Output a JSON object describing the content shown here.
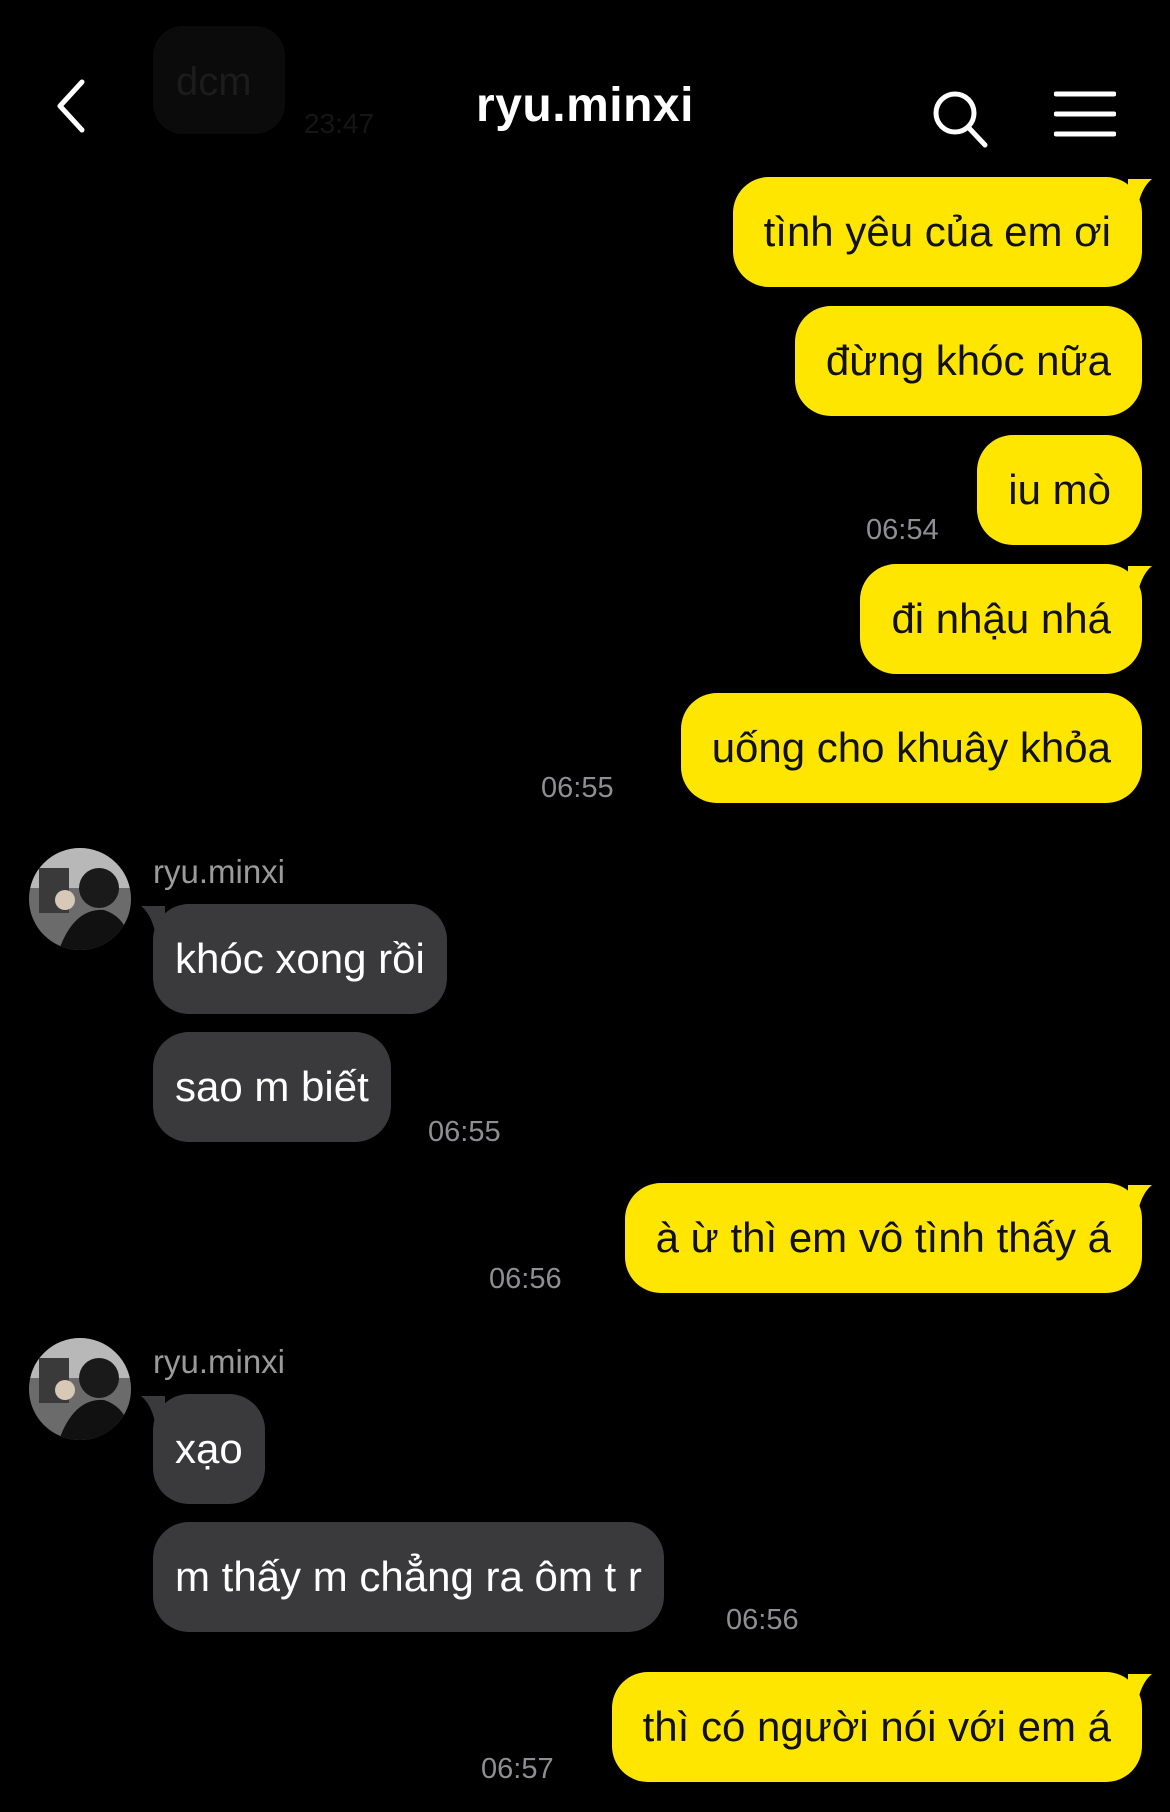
{
  "header": {
    "title": "ryu.minxi",
    "back_icon": "chevron-left-icon",
    "search_icon": "search-icon",
    "menu_icon": "hamburger-menu-icon",
    "previous_message": {
      "text": "dcm",
      "time": "23:47"
    }
  },
  "colors": {
    "background": "#000000",
    "outgoing_bubble": "#ffe600",
    "incoming_bubble": "#3a3a3c",
    "timestamp": "#8e8e93"
  },
  "messages": [
    {
      "direction": "out",
      "text": "tình yêu của em ơi",
      "time": ""
    },
    {
      "direction": "out",
      "text": "đừng khóc nữa",
      "time": ""
    },
    {
      "direction": "out",
      "text": "iu mò",
      "time": "06:54"
    },
    {
      "direction": "out",
      "text": "đi nhậu nhá",
      "time": ""
    },
    {
      "direction": "out",
      "text": "uống cho khuây khỏa",
      "time": "06:55"
    },
    {
      "direction": "in",
      "sender": "ryu.minxi",
      "text": "khóc xong rồi",
      "time": ""
    },
    {
      "direction": "in",
      "text": "sao m biết",
      "time": "06:55"
    },
    {
      "direction": "out",
      "text": "à ừ thì em vô tình thấy á",
      "time": "06:56"
    },
    {
      "direction": "in",
      "sender": "ryu.minxi",
      "text": "xạo",
      "time": ""
    },
    {
      "direction": "in",
      "text": "m thấy m chẳng ra ôm t r",
      "time": "06:56"
    },
    {
      "direction": "out",
      "text": "thì có người nói với em á",
      "time": "06:57"
    }
  ]
}
